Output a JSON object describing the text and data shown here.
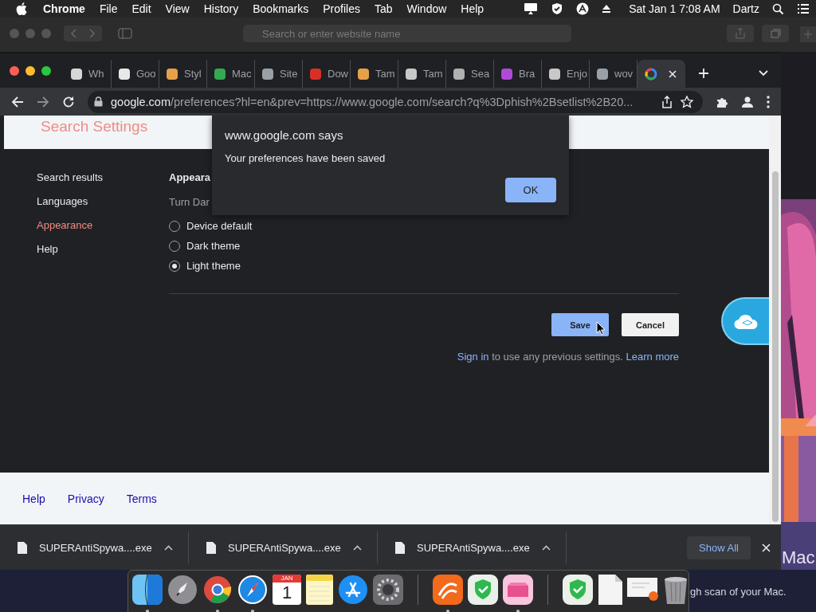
{
  "menu_bar": {
    "app": "Chrome",
    "menus": [
      "File",
      "Edit",
      "View",
      "History",
      "Bookmarks",
      "Profiles",
      "Tab",
      "Window",
      "Help"
    ],
    "clock": "Sat Jan 1 7:08 AM",
    "user": "Dartz"
  },
  "background_window": {
    "address_placeholder": "Search or enter website name"
  },
  "browser": {
    "tabs": [
      {
        "title": "Wh",
        "color": "#d6d6d6",
        "selected": false
      },
      {
        "title": "Goo",
        "color": "#e8e8e8",
        "selected": false
      },
      {
        "title": "Styl",
        "color": "#e7a04a",
        "selected": false
      },
      {
        "title": "Mac",
        "color": "#34a853",
        "selected": false
      },
      {
        "title": "Site",
        "color": "#9aa0a6",
        "selected": false
      },
      {
        "title": "Dow",
        "color": "#d93025",
        "selected": false
      },
      {
        "title": "Tam",
        "color": "#e7a04a",
        "selected": false
      },
      {
        "title": "Tam",
        "color": "#c8c8c8",
        "selected": false
      },
      {
        "title": "Sea",
        "color": "#b0b0b0",
        "selected": false
      },
      {
        "title": "Bra",
        "color": "#b04ad6",
        "selected": false
      },
      {
        "title": "Enjo",
        "color": "#c8c8c8",
        "selected": false
      },
      {
        "title": "wov",
        "color": "#9aa0a6",
        "selected": false
      },
      {
        "selected": true
      }
    ],
    "url": {
      "host": "google.com",
      "path": "/preferences?hl=en&prev=https://www.google.com/search?q%3Dphish%2Bsetlist%2B20..."
    }
  },
  "page": {
    "header": "Search Settings",
    "nav": [
      {
        "label": "Search results",
        "selected": false
      },
      {
        "label": "Languages",
        "selected": false
      },
      {
        "label": "Appearance",
        "selected": true
      },
      {
        "label": "Help",
        "selected": false
      }
    ],
    "section_title": "Appeara",
    "section_hint": "Turn Dar",
    "options": [
      {
        "label": "Device default",
        "selected": false
      },
      {
        "label": "Dark theme",
        "selected": false
      },
      {
        "label": "Light theme",
        "selected": true
      }
    ],
    "buttons": [
      {
        "label": "Save",
        "kind": "primary"
      },
      {
        "label": "Cancel",
        "kind": "secondary"
      }
    ],
    "note": {
      "link": "Sign in",
      "text": "to use any previous settings.",
      "link2": "Learn more"
    },
    "footer_links": [
      "Help",
      "Privacy",
      "Terms"
    ]
  },
  "dialog": {
    "title": "www.google.com says",
    "message": "Your preferences have been saved",
    "button": "OK"
  },
  "downloads": {
    "items": [
      {
        "name": "SUPERAntiSpywa....exe"
      },
      {
        "name": "SUPERAntiSpywa....exe"
      },
      {
        "name": "SUPERAntiSpywa....exe"
      }
    ],
    "show_all": "Show All"
  },
  "dock": {
    "items": [
      {
        "kind": "finder",
        "running": true
      },
      {
        "kind": "rocket",
        "running": false
      },
      {
        "kind": "browser",
        "running": true
      },
      {
        "kind": "compass",
        "running": true
      },
      {
        "kind": "calendar",
        "month": "JAN",
        "day": "1",
        "running": false
      },
      {
        "kind": "notes",
        "running": false
      },
      {
        "kind": "store",
        "running": false
      },
      {
        "kind": "gear",
        "running": false
      },
      {
        "kind": "separator"
      },
      {
        "kind": "orange-app",
        "running": true
      },
      {
        "kind": "shield",
        "running": false
      },
      {
        "kind": "pink-app",
        "running": true
      },
      {
        "kind": "separator"
      },
      {
        "kind": "shield",
        "running": false
      },
      {
        "kind": "document",
        "running": false
      },
      {
        "kind": "letter",
        "running": false
      },
      {
        "kind": "trash",
        "running": false
      }
    ]
  },
  "desktop": {
    "headline": "Mac",
    "subtitle": "gh scan of your Mac."
  }
}
